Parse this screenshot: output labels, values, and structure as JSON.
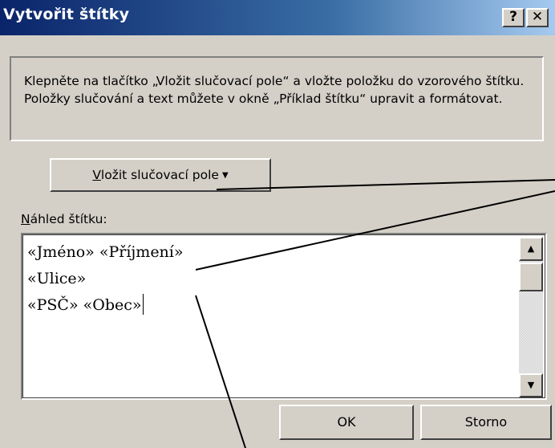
{
  "window": {
    "title": "Vytvořit štítky",
    "help_label": "?",
    "close_label": "✕"
  },
  "instructions": "Klepněte na tlačítko „Vložit slučovací pole“ a vložte položku do vzorového štítku. Položky slučování a text můžete v okně „Příklad štítku“ upravit a formátovat.",
  "insert_field": {
    "label_underlined": "V",
    "label_rest": "ložit slučovací pole",
    "arrow": "▼"
  },
  "preview": {
    "label_underlined": "N",
    "label_rest": "áhled štítku:",
    "lines": [
      "«Jméno» «Příjmení»",
      "«Ulice»",
      "«PSČ» «Obec»"
    ]
  },
  "scrollbar": {
    "up_arrow": "▲",
    "down_arrow": "▼"
  },
  "buttons": {
    "ok": "OK",
    "cancel": "Storno"
  }
}
